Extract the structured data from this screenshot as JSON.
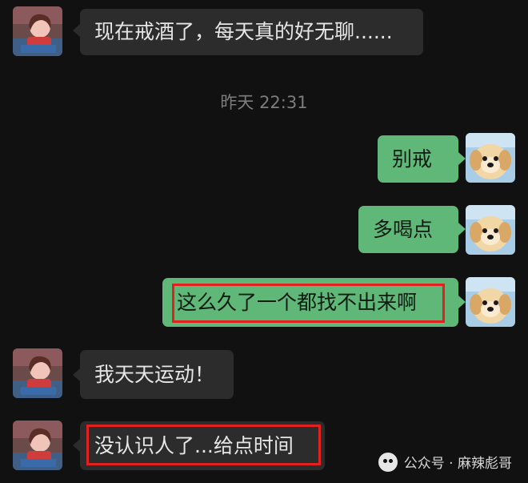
{
  "chat": {
    "timestamp": "昨天 22:31",
    "messages": [
      {
        "side": "in",
        "text": "现在戒酒了，每天真的好无聊......"
      },
      {
        "side": "out",
        "text": "别戒"
      },
      {
        "side": "out",
        "text": "多喝点"
      },
      {
        "side": "out",
        "text": "这么久了一个都找不出来啊",
        "highlighted": true
      },
      {
        "side": "in",
        "text": "我天天运动！"
      },
      {
        "side": "in",
        "text": "没认识人了...给点时间",
        "highlighted": true
      }
    ]
  },
  "watermark": {
    "text": "公众号 · 麻辣彪哥"
  },
  "colors": {
    "background": "#111111",
    "incoming_bubble": "#2c2c2c",
    "outgoing_bubble": "#5fb878",
    "highlight_border": "#e0211f",
    "timestamp_text": "#7d7d7d"
  },
  "icons": {
    "incoming_avatar": "girl-avatar",
    "outgoing_avatar": "puppy-avatar",
    "watermark_icon": "wechat-official-account-icon"
  }
}
